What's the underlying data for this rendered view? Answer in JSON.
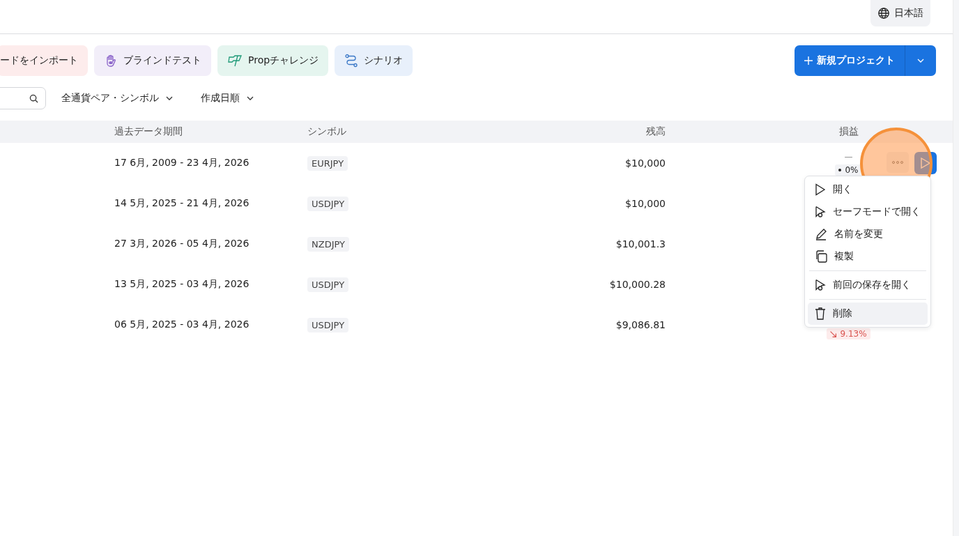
{
  "header": {
    "language_button": "日本語"
  },
  "quick_actions": [
    {
      "kind": "import",
      "label": "ードをインポート",
      "color": "#fdecec"
    },
    {
      "kind": "blind",
      "label": "ブラインドテスト",
      "color": "#f2eef9"
    },
    {
      "kind": "prop",
      "label": "Propチャレンジ",
      "color": "#e5f5ef"
    },
    {
      "kind": "scenario",
      "label": "シナリオ",
      "color": "#e8f0fb"
    }
  ],
  "new_project_button": "新規プロジェクト",
  "filters": {
    "symbol_filter": "全通貨ペア・シンボル",
    "sort": "作成日順"
  },
  "table": {
    "columns": [
      "過去データ期間",
      "シンボル",
      "残高",
      "損益"
    ],
    "rows": [
      {
        "period": "17 6月, 2009 - 23 4月, 2026",
        "symbol": "EURJPY",
        "balance": "$10,000",
        "pnl": {
          "value": "—",
          "change": "0%",
          "kind": "flat"
        },
        "hovered": true
      },
      {
        "period": "14 5月, 2025 - 21 4月, 2026",
        "symbol": "USDJPY",
        "balance": "$10,000",
        "hovered": false
      },
      {
        "period": "27 3月, 2026 - 05 4月, 2026",
        "symbol": "NZDJPY",
        "balance": "$10,001.3",
        "hovered": false
      },
      {
        "period": "13 5月, 2025 - 03 4月, 2026",
        "symbol": "USDJPY",
        "balance": "$10,000.28",
        "hovered": false
      },
      {
        "period": "06 5月, 2025 - 03 4月, 2026",
        "symbol": "USDJPY",
        "balance": "$9,086.81",
        "pnl": {
          "change": "9.13%",
          "kind": "down"
        },
        "hovered": false
      }
    ]
  },
  "context_menu": {
    "items": [
      {
        "kind": "open",
        "label": "開く",
        "hovered": false
      },
      {
        "kind": "safe",
        "label": "セーフモードで開く",
        "hovered": false
      },
      {
        "kind": "rename",
        "label": "名前を変更",
        "hovered": false
      },
      {
        "kind": "duplicate",
        "label": "複製",
        "hovered": false
      },
      {
        "kind": "separator"
      },
      {
        "kind": "restore",
        "label": "前回の保存を開く",
        "hovered": false
      },
      {
        "kind": "separator"
      },
      {
        "kind": "delete",
        "label": "削除",
        "hovered": true
      }
    ]
  },
  "spotlight": true
}
